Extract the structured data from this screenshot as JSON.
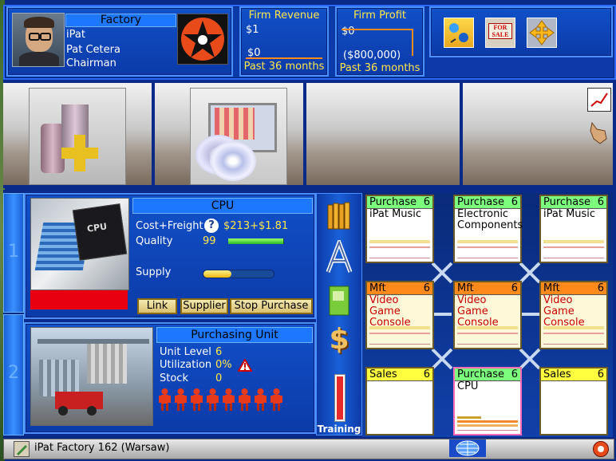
{
  "header": {
    "factory_label": "Factory",
    "firm_name": "iPat",
    "person_name": "Pat Cetera",
    "person_title": "Chairman",
    "revenue": {
      "title": "Firm Revenue",
      "top": "$1",
      "bottom": "$0",
      "period": "Past 36 months"
    },
    "profit": {
      "title": "Firm Profit",
      "top": "$0",
      "bottom": "($800,000)",
      "period": "Past 36 months"
    },
    "icons": [
      "avatar-transfer-icon",
      "for-sale-sign-icon",
      "move-arrows-icon"
    ],
    "for_sale_text": "FOR SALE"
  },
  "side_tabs": [
    "1",
    "2"
  ],
  "unit1": {
    "title": "CPU",
    "cost_label": "Cost+Freight",
    "cost_value": "$213+$1.81",
    "quality_label": "Quality",
    "quality_value": "99",
    "quality_level": 0.99,
    "supply_label": "Supply",
    "supply_level": 0.4,
    "buttons": {
      "link": "Link",
      "supplier": "Supplier",
      "stop": "Stop Purchase"
    },
    "image_text": "CPU"
  },
  "unit2": {
    "title": "Purchasing Unit",
    "level_label": "Unit Level",
    "level_value": "6",
    "util_label": "Utilization",
    "util_value": "0%",
    "stock_label": "Stock",
    "stock_value": "0",
    "worker_count": 8
  },
  "mid_toolbar": {
    "training_label": "Training",
    "icons": [
      "books-icon",
      "letter-a-icon",
      "book-icon",
      "dollar-icon"
    ]
  },
  "grid": [
    {
      "type": "Purchase",
      "level": "6",
      "text": "iPat Music",
      "color": "#7cff7c",
      "text_color": "#000"
    },
    {
      "type": "Purchase",
      "level": "6",
      "text": "Electronic Components",
      "color": "#7cff7c",
      "text_color": "#000"
    },
    {
      "type": "Purchase",
      "level": "6",
      "text": "iPat Music",
      "color": "#7cff7c",
      "text_color": "#000"
    },
    {
      "type": "Mft",
      "level": "6",
      "text": "Video Game Console",
      "color": "#ff8a1c",
      "text_color": "#c80000"
    },
    {
      "type": "Mft",
      "level": "6",
      "text": "Video Game Console",
      "color": "#ff8a1c",
      "text_color": "#c80000"
    },
    {
      "type": "Mft",
      "level": "6",
      "text": "Video Game Console",
      "color": "#ff8a1c",
      "text_color": "#c80000"
    },
    {
      "type": "Sales",
      "level": "6",
      "text": "",
      "color": "#ffff40",
      "text_color": "#000"
    },
    {
      "type": "Purchase",
      "level": "6",
      "text": "CPU",
      "color": "#7cff7c",
      "text_color": "#000"
    },
    {
      "type": "Sales",
      "level": "6",
      "text": "",
      "color": "#ffff40",
      "text_color": "#000"
    }
  ],
  "status": {
    "text": "iPat Factory 162 (Warsaw)"
  }
}
